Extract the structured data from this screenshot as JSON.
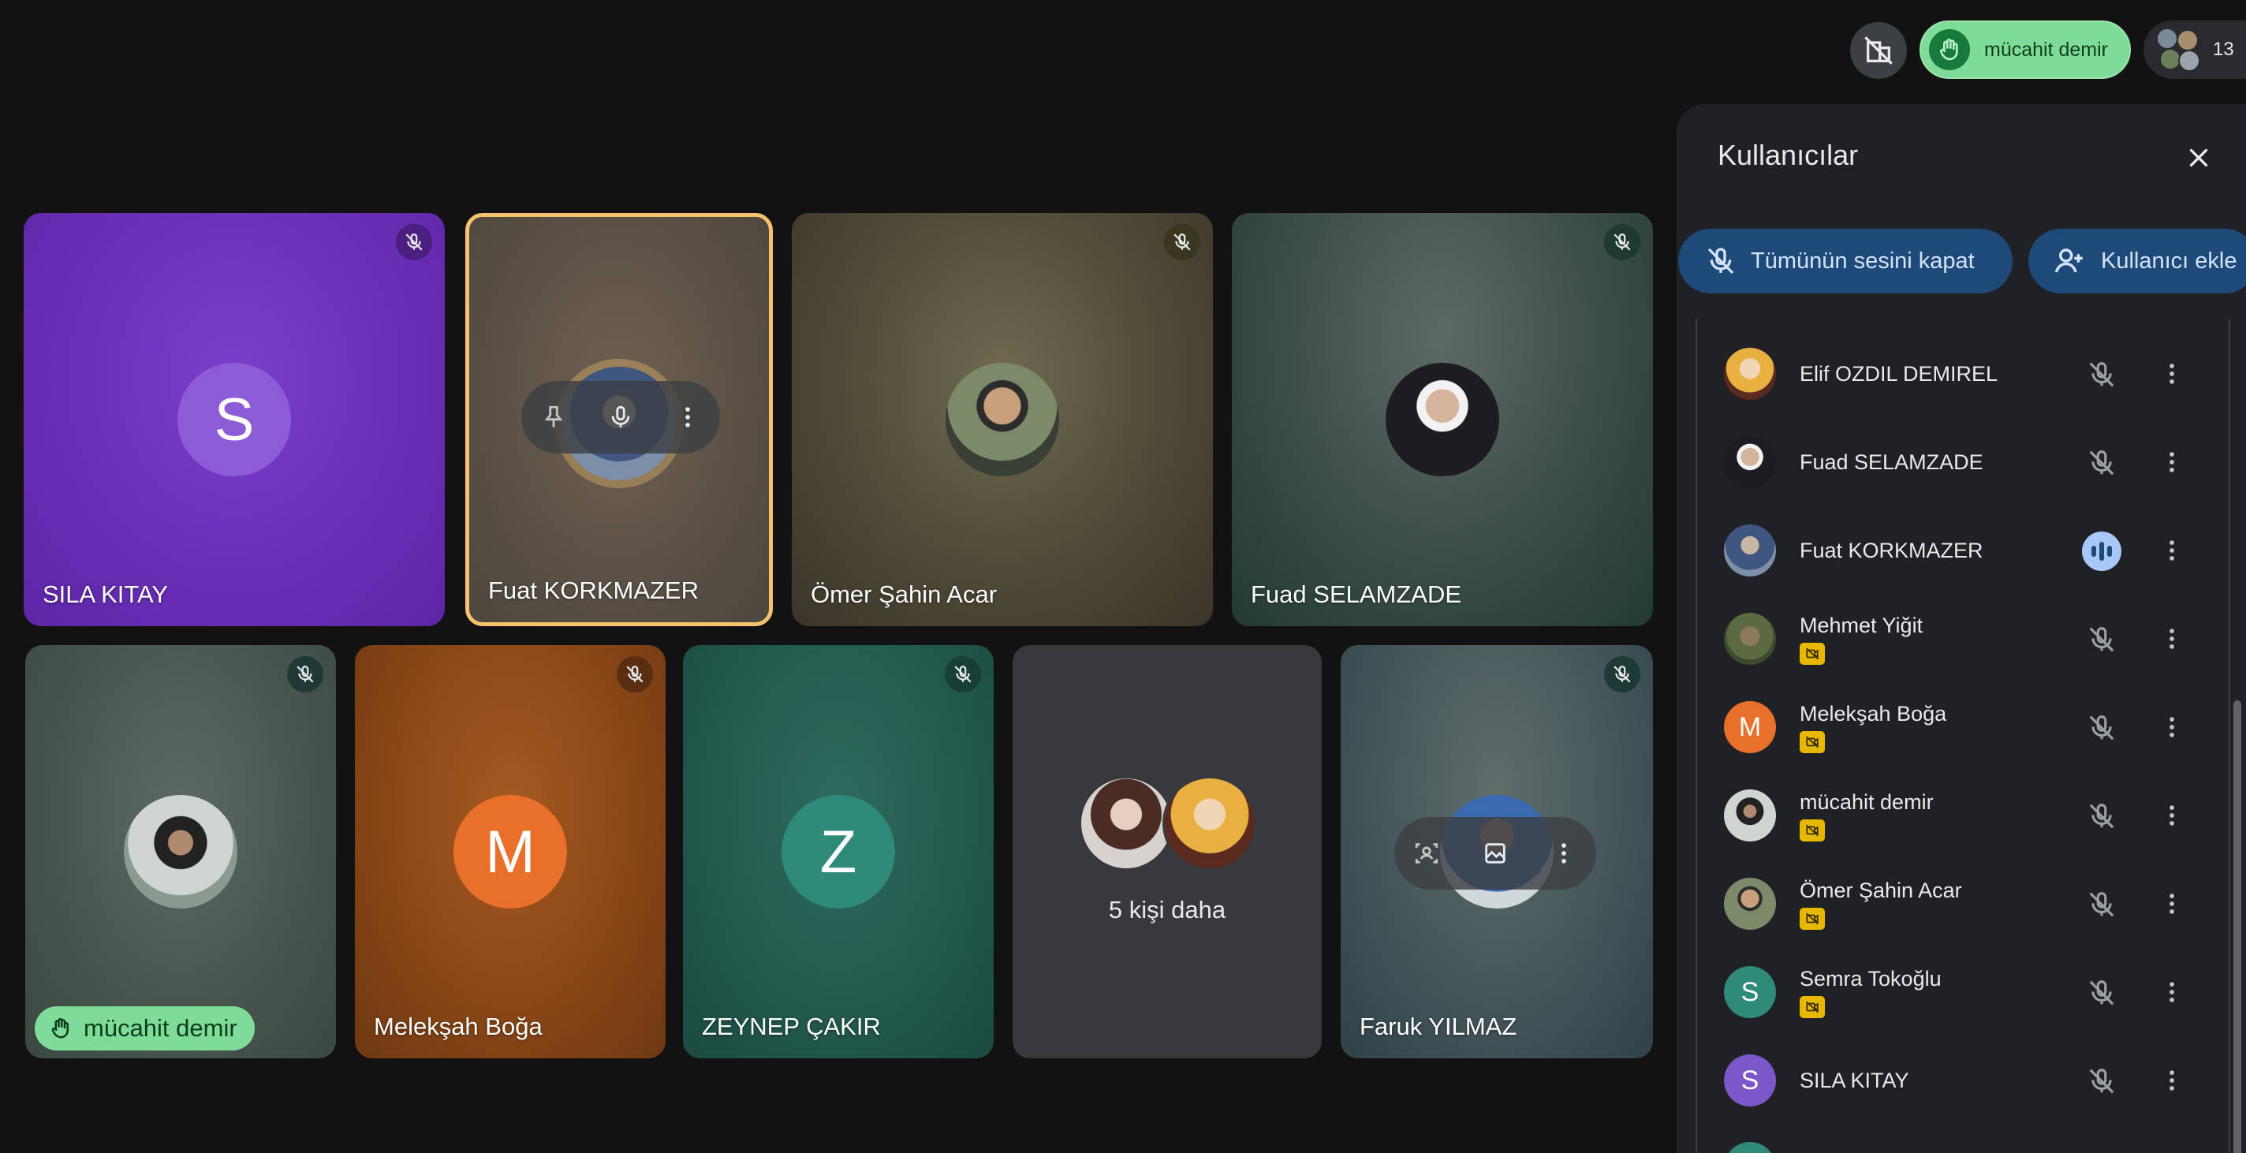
{
  "header": {
    "hand_raised_user": "mücahit demir",
    "participant_count": "13",
    "room_icon": "hidden-building-icon"
  },
  "colors": {
    "hand_green": "#7fdc98",
    "active_speaker_border": "#f6c26b",
    "panel_bg": "#202124",
    "action_button_bg": "#1e4a7a",
    "camera_off_badge": "#e6b800"
  },
  "tiles": [
    {
      "name": "SILA KITAY",
      "avatar_letter": "S",
      "muted": true
    },
    {
      "name": "Fuat KORKMAZER",
      "muted": false,
      "active_speaker": true
    },
    {
      "name": "Ömer Şahin Acar",
      "muted": true
    },
    {
      "name": "Fuad SELAMZADE",
      "muted": true
    },
    {
      "name": "mücahit demir",
      "muted": true,
      "hand_raised": true
    },
    {
      "name": "Melekşah Boğa",
      "avatar_letter": "M",
      "muted": true
    },
    {
      "name": "ZEYNEP ÇAKIR",
      "avatar_letter": "Z",
      "muted": true
    },
    {
      "more_label": "5 kişi daha"
    },
    {
      "name": "Faruk YILMAZ",
      "muted": true
    }
  ],
  "panel": {
    "title": "Kullanıcılar",
    "mute_all_label": "Tümünün sesini kapat",
    "add_user_label": "Kullanıcı ekle",
    "people": [
      {
        "name": "Elif OZDIL DEMIREL",
        "camera_off": false,
        "speaking": false
      },
      {
        "name": "Fuad SELAMZADE",
        "camera_off": false,
        "speaking": false
      },
      {
        "name": "Fuat KORKMAZER",
        "camera_off": false,
        "speaking": true
      },
      {
        "name": "Mehmet Yiğit",
        "camera_off": true,
        "speaking": false
      },
      {
        "name": "Melekşah Boğa",
        "avatar_letter": "M",
        "camera_off": true,
        "speaking": false
      },
      {
        "name": "mücahit demir",
        "camera_off": true,
        "speaking": false
      },
      {
        "name": "Ömer Şahin Acar",
        "camera_off": true,
        "speaking": false
      },
      {
        "name": "Semra Tokoğlu",
        "avatar_letter": "S",
        "camera_off": true,
        "speaking": false
      },
      {
        "name": "SILA KITAY",
        "avatar_letter": "S",
        "camera_off": false,
        "speaking": false
      }
    ]
  }
}
